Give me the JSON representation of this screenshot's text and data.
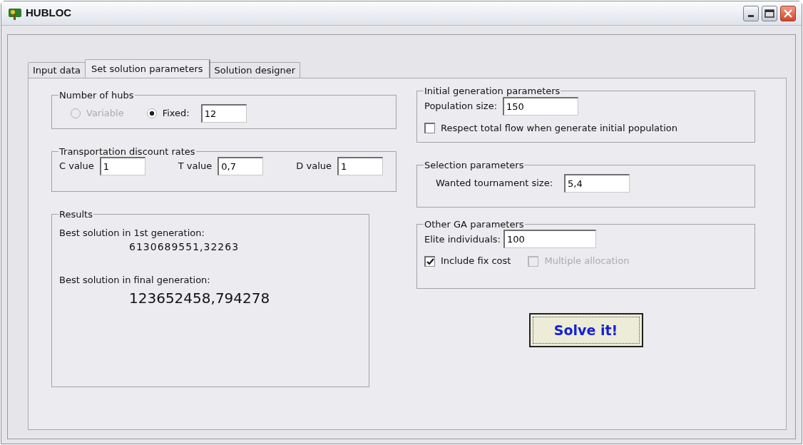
{
  "window": {
    "title": "HUBLOC"
  },
  "tabs": [
    {
      "label": "Input data",
      "selected": false
    },
    {
      "label": "Set solution parameters",
      "selected": true
    },
    {
      "label": "Solution designer",
      "selected": false
    }
  ],
  "number_of_hubs": {
    "title": "Number of hubs",
    "options": [
      {
        "label": "Variable",
        "selected": false,
        "disabled": true
      },
      {
        "label": "Fixed:",
        "selected": true,
        "disabled": false
      }
    ],
    "value": "12"
  },
  "discount_rates": {
    "title": "Transportation discount rates",
    "fields": [
      {
        "label": "C value",
        "value": "1"
      },
      {
        "label": "T value",
        "value": "0,7"
      },
      {
        "label": "D value",
        "value": "1"
      }
    ]
  },
  "results": {
    "title": "Results",
    "first_label": "Best solution in 1st generation:",
    "first_value": "6130689551,32263",
    "final_label": "Best solution in final generation:",
    "final_value": "123652458,794278"
  },
  "initial_generation": {
    "title": "Initial generation parameters",
    "population_label": "Population size:",
    "population_value": "150",
    "checkboxes": [
      {
        "label": "Respect total flow when generate initial population",
        "checked": false,
        "disabled": false
      }
    ]
  },
  "selection": {
    "title": "Selection parameters",
    "tournament_label": "Wanted tournament size:",
    "tournament_value": "5,4"
  },
  "other_ga": {
    "title": "Other GA parameters",
    "elite_label": "Elite individuals:",
    "elite_value": "100",
    "checkboxes": [
      {
        "label": "Include fix cost",
        "checked": true,
        "disabled": false
      },
      {
        "label": "Multiple allocation",
        "checked": false,
        "disabled": true
      }
    ]
  },
  "solve_button": {
    "label": "Solve it!"
  }
}
